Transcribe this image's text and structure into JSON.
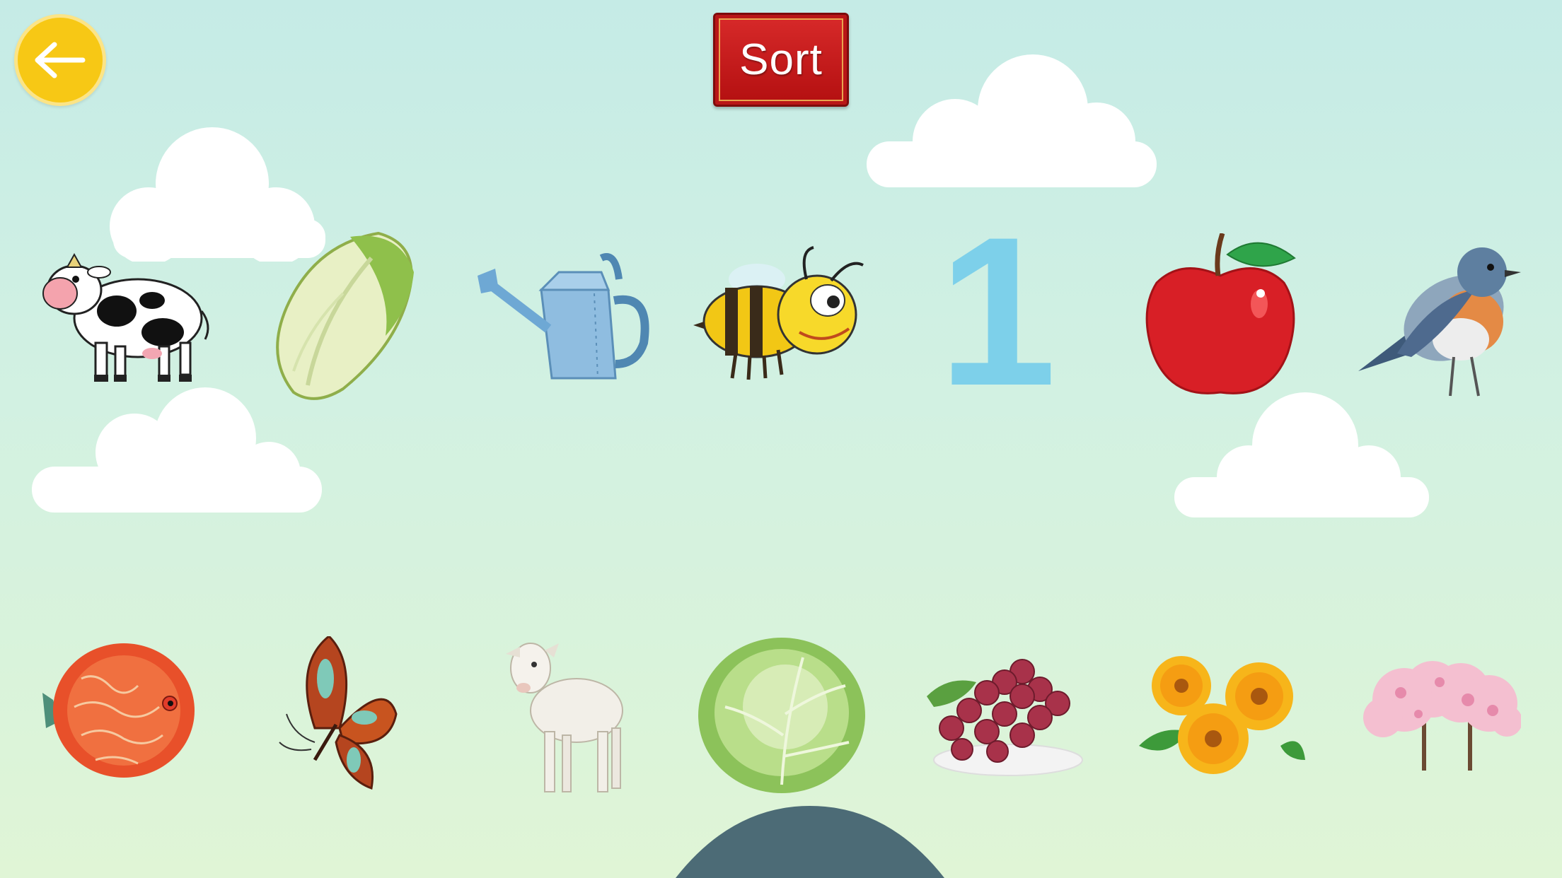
{
  "header": {
    "title": "Sort"
  },
  "back_button": {
    "icon": "arrow-left-icon"
  },
  "top_row": [
    {
      "name": "cow",
      "icon": "cow-icon"
    },
    {
      "name": "napa-cabbage",
      "icon": "napa-cabbage-icon"
    },
    {
      "name": "watering-can",
      "icon": "watering-can-icon"
    },
    {
      "name": "bee",
      "icon": "bee-icon"
    },
    {
      "name": "number-one",
      "text": "1"
    },
    {
      "name": "apple",
      "icon": "apple-icon"
    },
    {
      "name": "bird",
      "icon": "bird-icon"
    }
  ],
  "bottom_row": [
    {
      "name": "fish",
      "icon": "fish-icon"
    },
    {
      "name": "butterfly",
      "icon": "butterfly-icon"
    },
    {
      "name": "goat",
      "icon": "goat-icon"
    },
    {
      "name": "cabbage",
      "icon": "cabbage-icon"
    },
    {
      "name": "grapes",
      "icon": "grapes-icon"
    },
    {
      "name": "flowers",
      "icon": "flowers-icon"
    },
    {
      "name": "tree",
      "icon": "blossom-tree-icon"
    }
  ],
  "colors": {
    "back_button": "#f7c815",
    "title_plaque": "#c41b1c",
    "number": "#7dd0ea",
    "hill": "#4c6b76"
  }
}
